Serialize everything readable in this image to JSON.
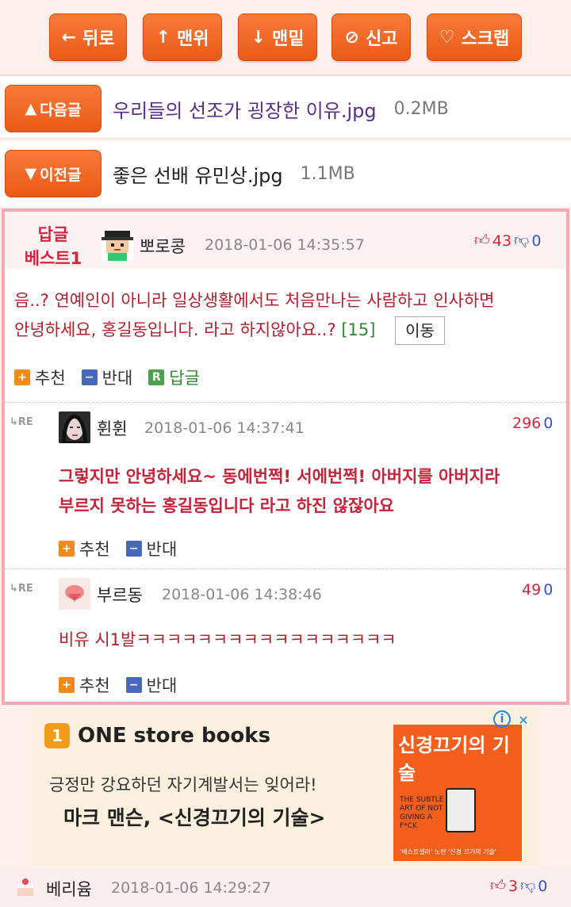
{
  "topbar": {
    "buttons": [
      {
        "icon": "←",
        "label": "뒤로"
      },
      {
        "icon": "↑",
        "label": "맨위"
      },
      {
        "icon": "↓",
        "label": "맨밑"
      },
      {
        "icon": "⊘",
        "label": "신고"
      },
      {
        "icon": "♡",
        "label": "스크랩"
      }
    ]
  },
  "next_post": {
    "button": "다음글",
    "title": "우리들의 선조가 굉장한 이유.jpg",
    "size": "0.2MB"
  },
  "prev_post": {
    "button": "이전글",
    "title": "좋은 선배 유민상.jpg",
    "size": "1.1MB"
  },
  "best_reply": {
    "label_line1": "답글",
    "label_line2": "베스트1",
    "nickname": "뽀로콩",
    "datetime": "2018-01-06 14:35:57",
    "up_votes": "43",
    "down_votes": "0",
    "text_line1": "음..? 연예인이 아니라 일상생활에서도 처음만나는 사람하고 인사하면",
    "text_line2": "안녕하세요, 홍길동입니다. 라고 하지않아요..?",
    "ref_count": "[15]",
    "move_button": "이동",
    "actions": {
      "recommend": "추천",
      "oppose": "반대",
      "reply": "답글"
    }
  },
  "replies": [
    {
      "re_label": "RE",
      "nickname": "휜휜",
      "datetime": "2018-01-06 14:37:41",
      "up_votes": "296",
      "down_votes": "0",
      "text_line1": "그렇지만 안녕하세요~ 동에번쩍! 서에번쩍! 아버지를 아버지라",
      "text_line2": "부르지 못하는 홍길동입니다 라고 하진 않잖아요",
      "actions": {
        "recommend": "추천",
        "oppose": "반대"
      }
    },
    {
      "re_label": "RE",
      "nickname": "부르동",
      "datetime": "2018-01-06 14:38:46",
      "up_votes": "49",
      "down_votes": "0",
      "text_line1": "비유 시1발ㅋㅋㅋㅋㅋㅋㅋㅋㅋㅋㅋㅋㅋㅋㅋㅋㅋ",
      "actions": {
        "recommend": "추천",
        "oppose": "반대"
      }
    }
  ],
  "ad": {
    "brand": "ONE store books",
    "brand_icon": "1",
    "line1": "긍정만 강요하던 자기계발서는 잊어라!",
    "line2": "마크 맨슨, <신경끄기의 기술>",
    "book_title": "신경끄기의 기술",
    "book_sub": "THE SUBTLE ART OF NOT GIVING A F*CK",
    "book_foot": "'베스트셀러' 노란 '신경 끄기의 기술'",
    "info_icon": "i",
    "close_icon": "✕"
  },
  "bottom_comment": {
    "nickname": "베리윰",
    "datetime": "2018-01-06 14:29:27",
    "up_votes": "3",
    "down_votes": "0"
  }
}
